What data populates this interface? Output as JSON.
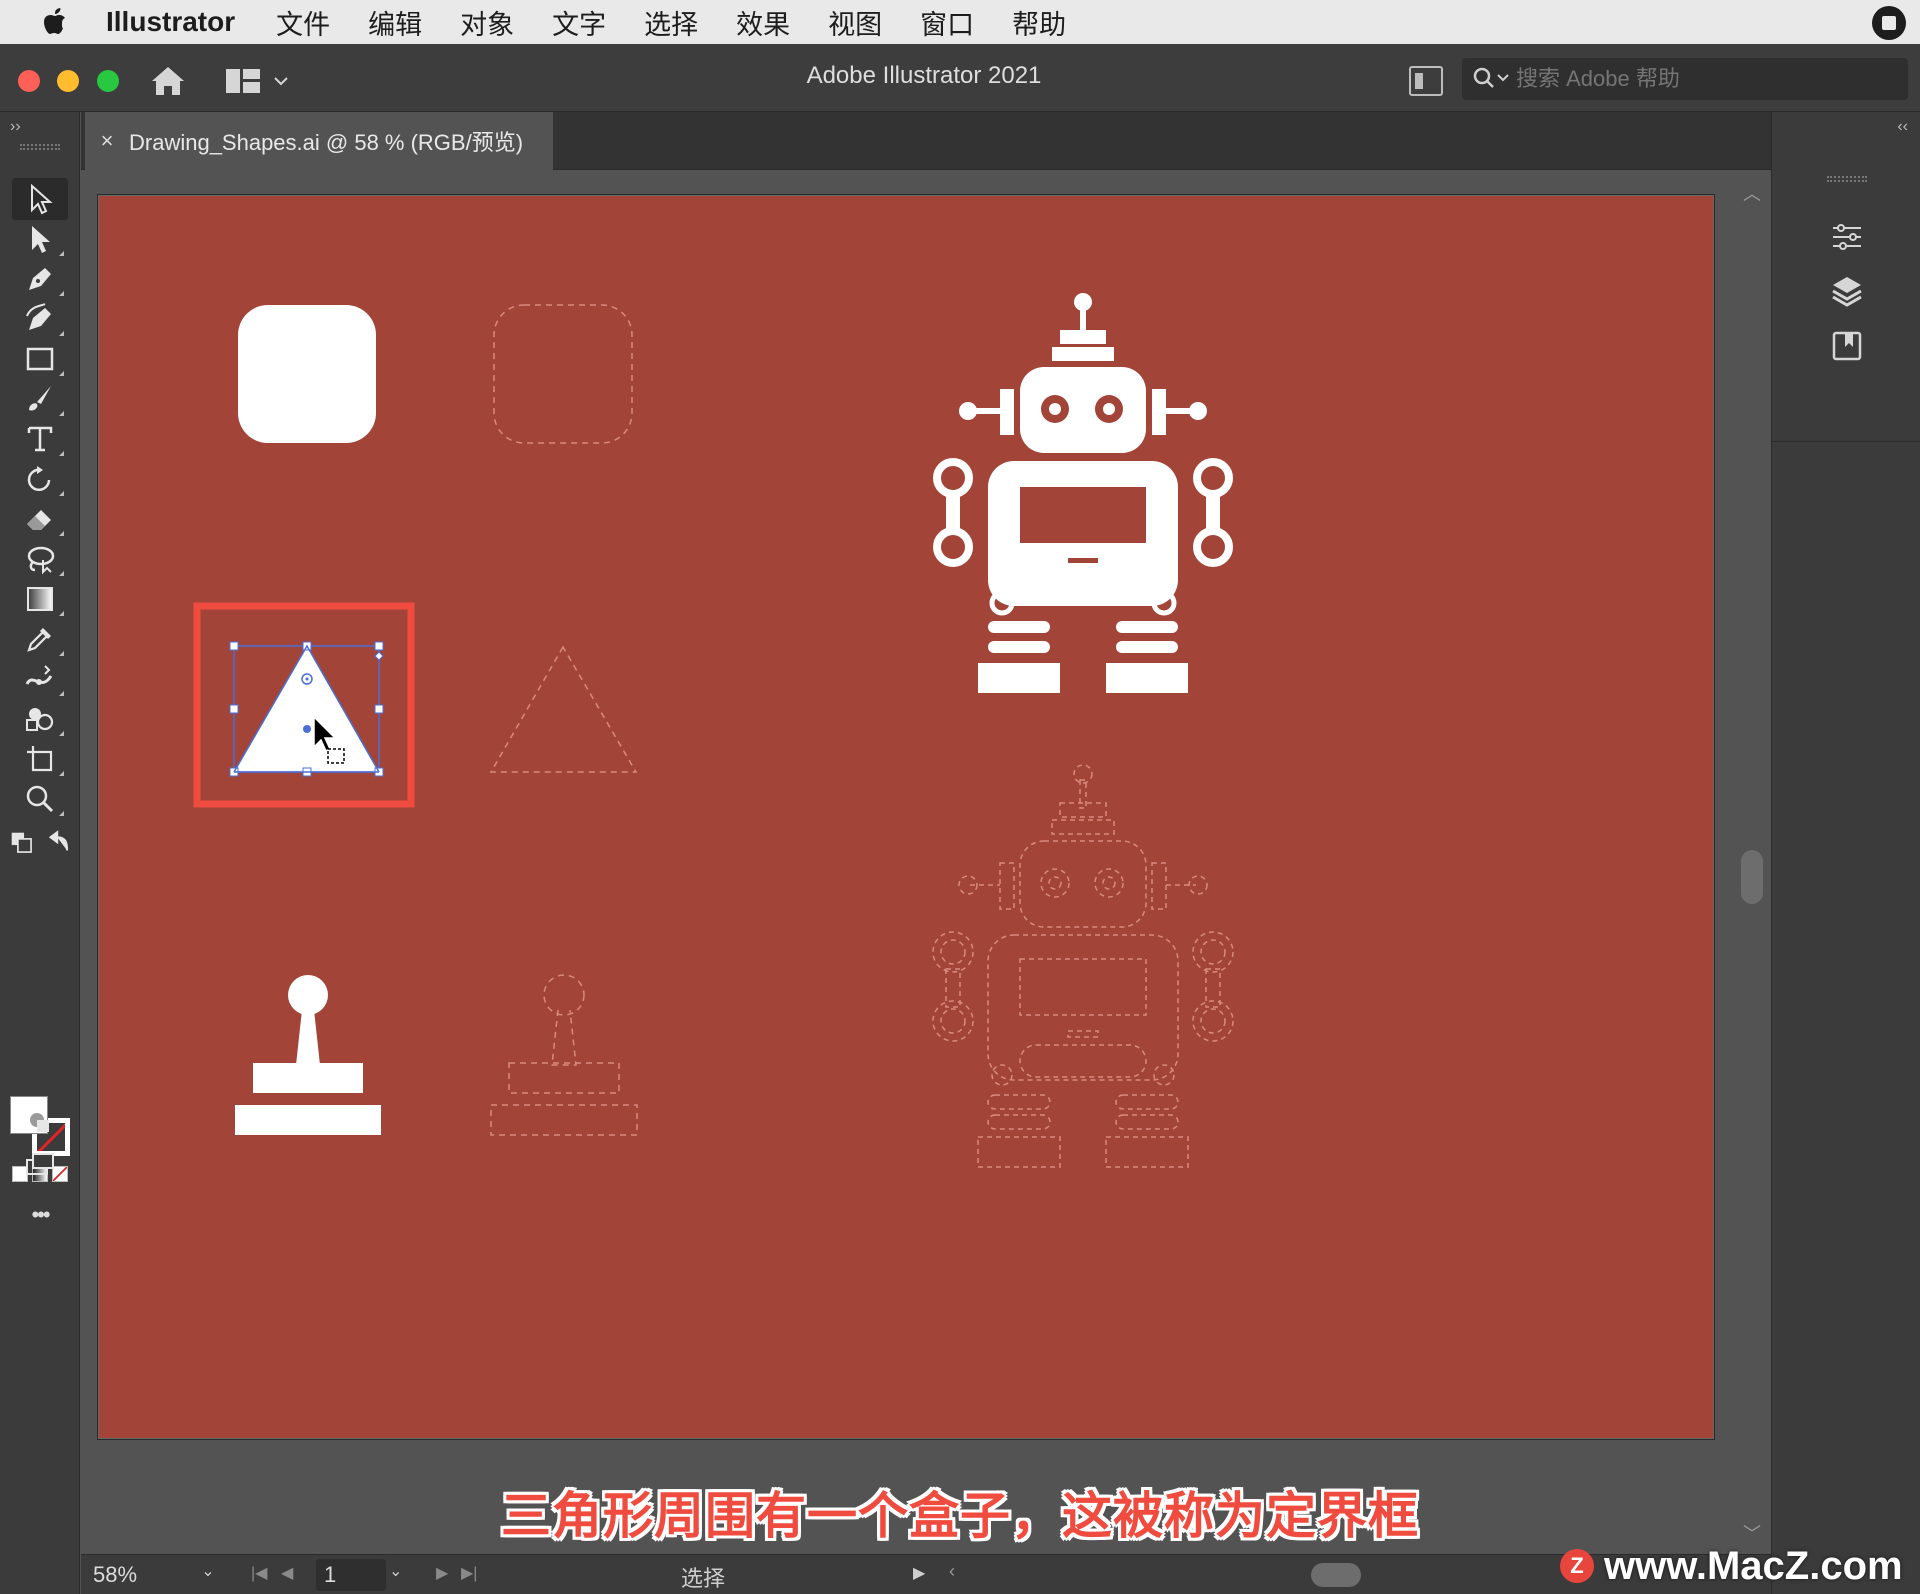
{
  "menubar": {
    "apple_icon": "apple-logo",
    "app_name": "Illustrator",
    "items": [
      "文件",
      "编辑",
      "对象",
      "文字",
      "选择",
      "效果",
      "视图",
      "窗口",
      "帮助"
    ]
  },
  "titlebar": {
    "title": "Adobe Illustrator 2021",
    "search_placeholder": "搜索 Adobe 帮助"
  },
  "document_tab": {
    "close": "×",
    "label": "Drawing_Shapes.ai @ 58 % (RGB/预览)"
  },
  "toolbar": {
    "collapse": "››",
    "tools": [
      "selection-tool",
      "direct-selection-tool",
      "pen-tool",
      "curvature-tool",
      "rectangle-tool",
      "paintbrush-tool",
      "type-tool",
      "rotate-tool",
      "eraser-tool",
      "lasso-tool",
      "gradient-tool",
      "eyedropper-tool",
      "width-tool",
      "shape-builder-tool",
      "artboard-tool",
      "zoom-tool"
    ],
    "more": "•••",
    "fill_color": "#ffffff",
    "stroke_color": "none"
  },
  "right_dock": {
    "collapse": "‹‹",
    "panels": [
      "properties-panel-icon",
      "layers-panel-icon",
      "libraries-panel-icon"
    ]
  },
  "canvas": {
    "artboard_color": "#a24538",
    "highlight_color": "#ef4b3f",
    "selection_color": "#4a6fd6"
  },
  "statusbar": {
    "zoom": "58%",
    "page": "1",
    "tool_name": "选择"
  },
  "subtitle": "三角形周围有一个盒子，这被称为定界框",
  "watermark": {
    "logo": "Z",
    "text": "www.MacZ.com"
  }
}
